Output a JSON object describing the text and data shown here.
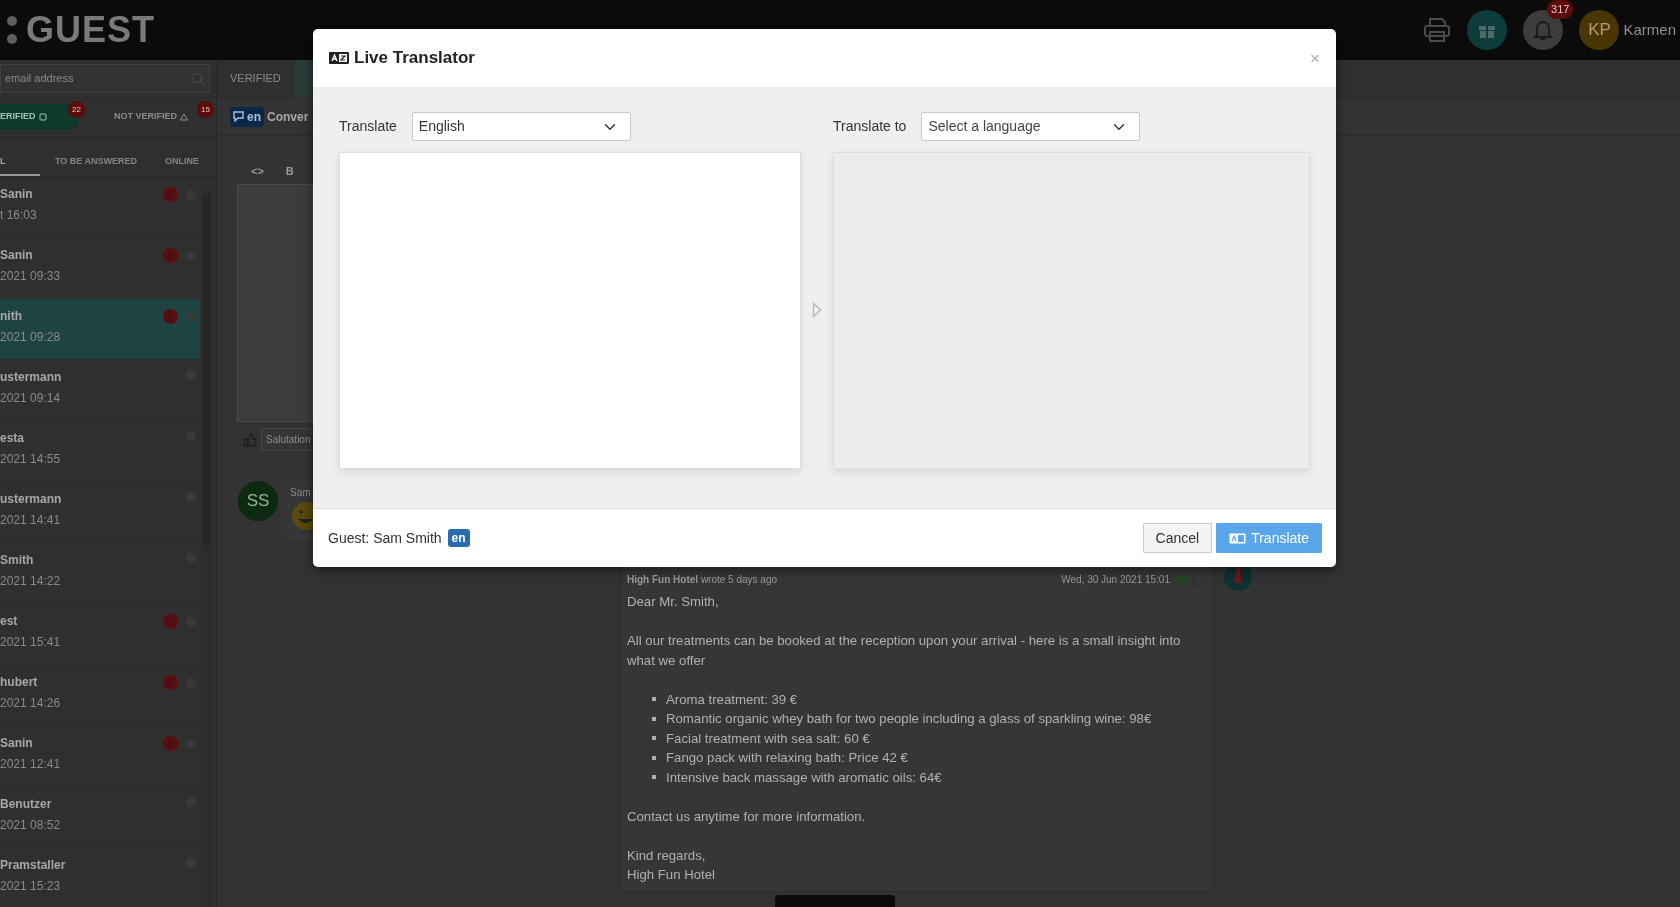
{
  "topbar": {
    "logo": "GUEST",
    "notification_count": "317",
    "user": {
      "initials": "KP",
      "name": "Karmen"
    }
  },
  "sidebar": {
    "search": {
      "placeholder": "email address"
    },
    "filters": [
      {
        "label": "ERIFIED",
        "count": "22",
        "selected": true
      },
      {
        "label": "NOT VERIFIED",
        "count": "15",
        "selected": false
      }
    ],
    "tabs": [
      {
        "label": "L",
        "selected": true
      },
      {
        "label": "TO BE ANSWERED",
        "selected": false
      },
      {
        "label": "ONLINE",
        "selected": false
      }
    ],
    "conversations": [
      {
        "name": "Sanin",
        "time": "t 16:03",
        "unanswered": true,
        "selected": false
      },
      {
        "name": "Sanin",
        "time": "2021 09:33",
        "unanswered": true,
        "selected": false
      },
      {
        "name": "nith",
        "time": "2021 09:28",
        "unanswered": true,
        "selected": true
      },
      {
        "name": "ustermann",
        "time": "2021 09:14",
        "unanswered": false,
        "selected": false
      },
      {
        "name": "esta",
        "time": "2021 14:55",
        "unanswered": false,
        "selected": false
      },
      {
        "name": "ustermann",
        "time": "2021 14:41",
        "unanswered": false,
        "selected": false
      },
      {
        "name": "Smith",
        "time": "2021 14:22",
        "unanswered": false,
        "selected": false
      },
      {
        "name": "est",
        "time": "2021 15:41",
        "unanswered": true,
        "selected": false
      },
      {
        "name": "hubert",
        "time": "2021 14:26",
        "unanswered": true,
        "selected": false
      },
      {
        "name": "Sanin",
        "time": "2021 12:41",
        "unanswered": true,
        "selected": false
      },
      {
        "name": "Benutzer",
        "time": "2021 08:52",
        "unanswered": false,
        "selected": false
      },
      {
        "name": "Pramstaller",
        "time": "2021 15:23",
        "unanswered": false,
        "selected": false
      }
    ]
  },
  "conversation": {
    "status": "VERIFIED",
    "language": "en",
    "title": "Conver",
    "editor": {
      "toolbar": [
        "<>",
        "B"
      ],
      "quick_reply": "Salutation"
    },
    "messages": [
      {
        "kind": "guest",
        "initials": "SS",
        "author": "Sam"
      },
      {
        "kind": "hotel",
        "header": "**High Fun Hotel** wrote 5 days ago",
        "date": "Wed, 30 Jun 2021 15:01",
        "delivered": true,
        "body": [
          {
            "kind": "text",
            "lines": [
              "Dear Mr. Smith,"
            ]
          },
          {
            "kind": "text",
            "lines": [
              "All our treatments can be booked at the reception upon your arrival - here is a small insight into what we offer"
            ]
          },
          {
            "kind": "list",
            "items": [
              "Aroma treatment: 39 €",
              "Romantic organic whey bath for two people including a glass of sparkling wine: 98€",
              "Facial treatment with sea salt: 60 €",
              "Fango pack with relaxing bath: Price 42 €",
              "Intensive back massage with aromatic oils: 64€"
            ]
          },
          {
            "kind": "text",
            "lines": [
              "Contact us anytime for more information."
            ]
          },
          {
            "kind": "text",
            "lines": [
              "Kind regards,",
              "High Fun Hotel"
            ]
          }
        ]
      }
    ]
  },
  "modal": {
    "title": "Live Translator",
    "close": "×",
    "source": {
      "label": "Translate",
      "language": "English"
    },
    "target": {
      "label": "Translate to",
      "placeholder": "Select a language"
    },
    "guest": {
      "label": "Guest: Sam Smith",
      "language": "en"
    },
    "buttons": [
      {
        "label": "Cancel",
        "kind": "secondary"
      },
      {
        "label": "Translate",
        "kind": "primary"
      }
    ]
  }
}
